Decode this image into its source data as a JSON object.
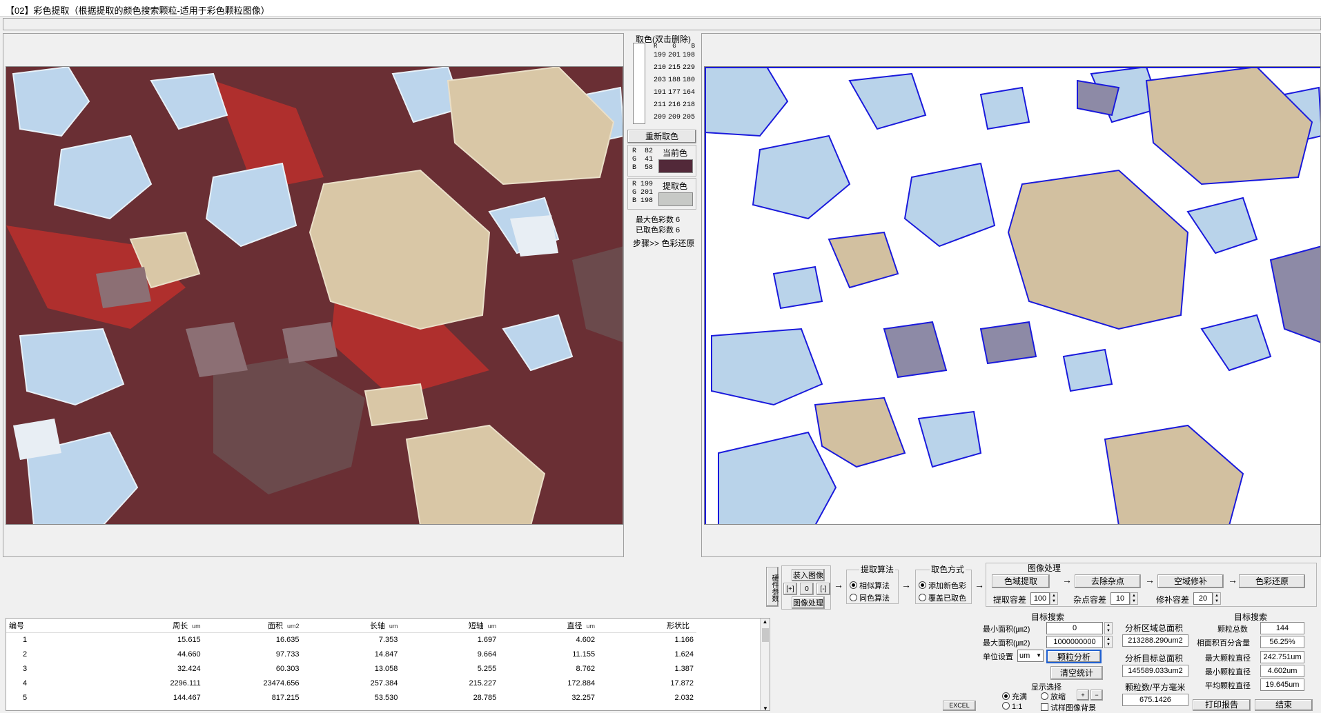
{
  "window": {
    "title": "【02】彩色提取（根据提取的颜色搜索颗粒-适用于彩色颗粒图像）"
  },
  "color_list": {
    "title": "取色(双击删除)",
    "headers": [
      "R",
      "G",
      "B"
    ],
    "rows": [
      [
        "199",
        "201",
        "198"
      ],
      [
        "210",
        "215",
        "229"
      ],
      [
        "203",
        "188",
        "180"
      ],
      [
        "191",
        "177",
        "164"
      ],
      [
        "211",
        "216",
        "218"
      ],
      [
        "209",
        "209",
        "205"
      ]
    ]
  },
  "reselect_button": "重新取色",
  "current_color": {
    "r_label": "R",
    "g_label": "G",
    "b_label": "B",
    "r": "82",
    "g": "41",
    "b": "58",
    "label": "当前色",
    "hex": "#522939"
  },
  "extract_color": {
    "r_label": "R",
    "g_label": "G",
    "b_label": "B",
    "r": "199",
    "g": "201",
    "b": "198",
    "label": "提取色",
    "hex": "#c7c9c6"
  },
  "max_colors": "最大色彩数 6",
  "picked_colors": "已取色彩数 6",
  "step_label": "步骤>> 色彩还原",
  "side_tab": "硬件参数",
  "image_load": {
    "load": "装入图像",
    "plus": "[+]",
    "zero": "0",
    "minus": "[-]",
    "process": "图像处理"
  },
  "algo": {
    "title": "提取算法",
    "opt1": "相似算法",
    "opt2": "同色算法"
  },
  "pick_mode": {
    "title": "取色方式",
    "opt1": "添加新色彩",
    "opt2": "覆盖已取色"
  },
  "processing": {
    "title": "图像处理",
    "color_extract": "色域提取",
    "remove_noise": "去除杂点",
    "fill_holes": "空域修补",
    "color_restore": "色彩还原",
    "extract_tol_label": "提取容差",
    "extract_tol": "100",
    "noise_tol_label": "杂点容差",
    "noise_tol": "10",
    "fill_tol_label": "修补容差",
    "fill_tol": "20"
  },
  "target_search": {
    "title": "目标搜索",
    "min_area_label": "最小面积(㎛2)",
    "min_area": "0",
    "max_area_label": "最大面积(㎛2)",
    "max_area": "1000000000",
    "unit_label": "单位设置",
    "unit": "um",
    "analyze_btn": "颗粒分析",
    "clear_btn": "清空统计"
  },
  "display": {
    "title": "显示选择",
    "fill": "充满",
    "zoom": "放缩",
    "one": "1:1",
    "bg": "试样图像背景"
  },
  "excel_btn": "EXCEL",
  "stats_left": {
    "total_area_label": "分析区域总面积",
    "total_area": "213288.290um2",
    "target_area_label": "分析目标总面积",
    "target_area": "145589.033um2",
    "density_label": "颗粒数/平方毫米",
    "density": "675.1426"
  },
  "stats_right": {
    "title": "目标搜索",
    "count_label": "颗粒总数",
    "count": "144",
    "pct_label": "相面积百分含量",
    "pct": "56.25%",
    "max_d_label": "最大颗粒直径",
    "max_d": "242.751um",
    "min_d_label": "最小颗粒直径",
    "min_d": "4.602um",
    "avg_d_label": "平均颗粒直径",
    "avg_d": "19.645um"
  },
  "print_btn": "打印报告",
  "end_btn": "结束",
  "table": {
    "headers": [
      {
        "name": "编号",
        "unit": ""
      },
      {
        "name": "周长",
        "unit": "um"
      },
      {
        "name": "面积",
        "unit": "um2"
      },
      {
        "name": "长轴",
        "unit": "um"
      },
      {
        "name": "短轴",
        "unit": "um"
      },
      {
        "name": "直径",
        "unit": "um"
      },
      {
        "name": "形状比",
        "unit": ""
      }
    ],
    "rows": [
      [
        "1",
        "15.615",
        "16.635",
        "7.353",
        "1.697",
        "4.602",
        "1.166"
      ],
      [
        "2",
        "44.660",
        "97.733",
        "14.847",
        "9.664",
        "11.155",
        "1.624"
      ],
      [
        "3",
        "32.424",
        "60.303",
        "13.058",
        "5.255",
        "8.762",
        "1.387"
      ],
      [
        "4",
        "2296.111",
        "23474.656",
        "257.384",
        "215.227",
        "172.884",
        "17.872"
      ],
      [
        "5",
        "144.467",
        "817.215",
        "53.530",
        "28.785",
        "32.257",
        "2.032"
      ]
    ]
  },
  "colors": {
    "outline": "#1a1adc",
    "matrix_red": "#b52020",
    "grain_blue": "#b9d3ea",
    "grain_tan": "#d8c6a4"
  }
}
